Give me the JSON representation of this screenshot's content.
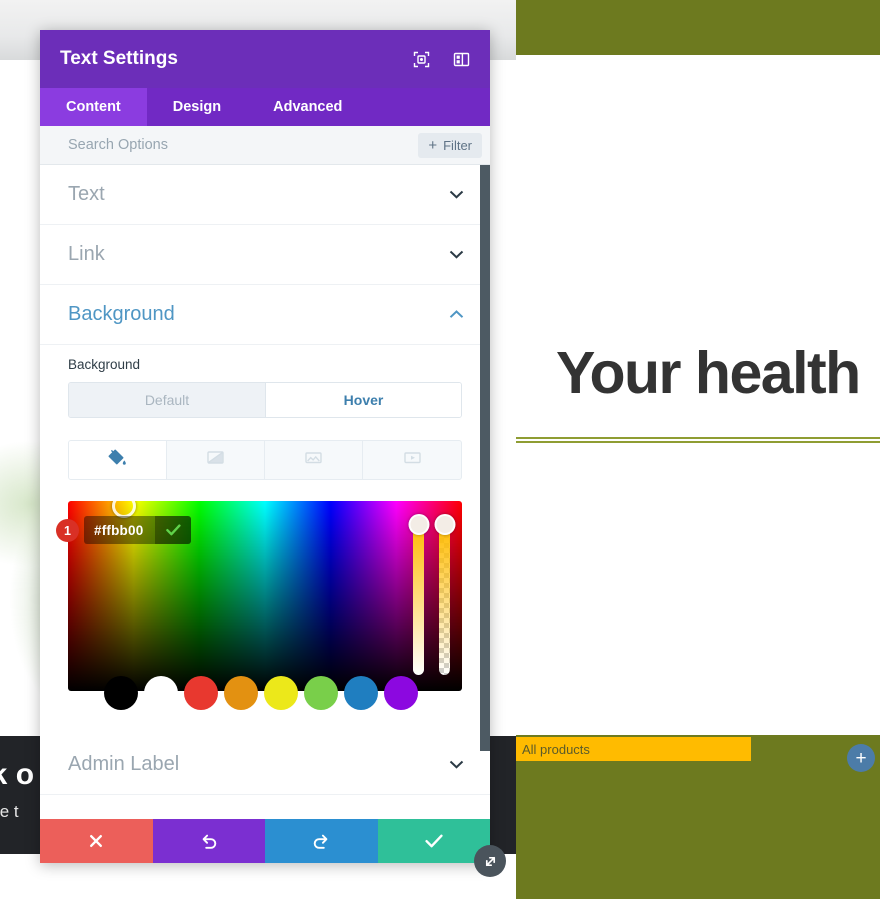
{
  "background_page": {
    "hero_heading": "Your health",
    "all_products_label": "All products",
    "add_button_label": "+",
    "promo_title": "ck o",
    "promo_subtitle": "love t",
    "colors": {
      "olive": "#6d7a1f",
      "olive_rule": "#8f9d33",
      "amber_button": "#ffbb00",
      "dark_band": "#222428",
      "fab_blue": "#4c7ca8",
      "heading": "#333333"
    }
  },
  "modal": {
    "title": "Text Settings",
    "header_icons": [
      {
        "name": "focus-target-icon"
      },
      {
        "name": "layout-panel-icon"
      }
    ],
    "tabs": [
      {
        "label": "Content",
        "active": true
      },
      {
        "label": "Design",
        "active": false
      },
      {
        "label": "Advanced",
        "active": false
      }
    ],
    "search": {
      "placeholder": "Search Options",
      "value": ""
    },
    "filter_button": {
      "plus": "+",
      "label": "Filter"
    },
    "accordions": [
      {
        "label": "Text",
        "open": false,
        "chevron": "chevron-down-icon"
      },
      {
        "label": "Link",
        "open": false,
        "chevron": "chevron-down-icon"
      },
      {
        "label": "Background",
        "open": true,
        "chevron": "chevron-up-icon"
      },
      {
        "label": "Admin Label",
        "open": false,
        "chevron": "chevron-down-icon"
      }
    ],
    "background_section": {
      "field_label": "Background",
      "state_toggle": {
        "default_label": "Default",
        "hover_label": "Hover",
        "selected": "Hover"
      },
      "type_tabs": [
        {
          "name": "background-color-icon",
          "active": true
        },
        {
          "name": "background-gradient-icon",
          "active": false
        },
        {
          "name": "background-image-icon",
          "active": false
        },
        {
          "name": "background-video-icon",
          "active": false
        }
      ],
      "color_picker": {
        "hex_value": "#ffbb00",
        "confirm_icon": "checkmark-icon",
        "step_badge": "1",
        "swatches": [
          {
            "name": "swatch-black",
            "hex": "#000000"
          },
          {
            "name": "swatch-white",
            "hex": "#ffffff"
          },
          {
            "name": "swatch-red",
            "hex": "#e8382f"
          },
          {
            "name": "swatch-orange",
            "hex": "#e39111"
          },
          {
            "name": "swatch-yellow",
            "hex": "#ece81a"
          },
          {
            "name": "swatch-green",
            "hex": "#79cf4a"
          },
          {
            "name": "swatch-blue",
            "hex": "#1f7ec0"
          },
          {
            "name": "swatch-purple",
            "hex": "#8c08e0"
          }
        ],
        "sliders": [
          {
            "name": "opacity-slider",
            "value": 100
          },
          {
            "name": "alpha-slider",
            "value": 100
          }
        ]
      }
    },
    "footer_buttons": [
      {
        "name": "cancel-button",
        "icon": "close-icon",
        "color": "#ec5f5a"
      },
      {
        "name": "undo-button",
        "icon": "undo-icon",
        "color": "#7b2fd1"
      },
      {
        "name": "redo-button",
        "icon": "redo-icon",
        "color": "#2b8fd1"
      },
      {
        "name": "save-button",
        "icon": "checkmark-icon",
        "color": "#2fc099"
      }
    ],
    "resize_handle": {
      "name": "resize-handle-icon"
    }
  }
}
